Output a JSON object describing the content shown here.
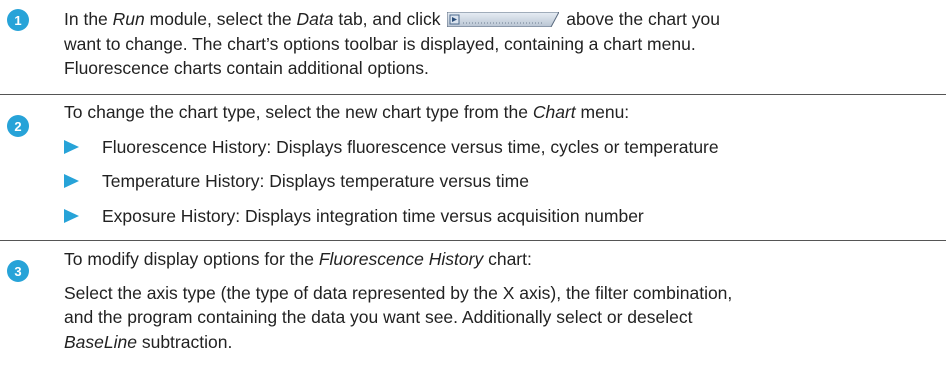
{
  "steps": [
    {
      "number": "1",
      "line1_a": "In the ",
      "line1_run": "Run",
      "line1_b": " module, select the ",
      "line1_data": "Data",
      "line1_c": " tab, and click ",
      "line1_d": " above the chart you",
      "line2": "want to change. The chart’s options toolbar is displayed, containing a chart menu.",
      "line3": "Fluorescence charts contain additional options."
    },
    {
      "number": "2",
      "intro_a": "To change the chart type, select the new chart type from the ",
      "intro_chart": "Chart",
      "intro_b": " menu:",
      "bullets": [
        "Fluorescence History: Displays fluorescence versus time, cycles or temperature",
        "Temperature History: Displays temperature versus time",
        "Exposure History: Displays integration time versus acquisition number"
      ]
    },
    {
      "number": "3",
      "intro_a": "To modify display options for the ",
      "intro_italic": "Fluorescence History",
      "intro_b": " chart:",
      "body1": "Select the axis type (the type of data represented by the X axis), the filter combination,",
      "body2": "and the program containing the data you want see. Additionally select or deselect",
      "body3_italic": "BaseLine",
      "body3_rest": " subtraction."
    }
  ],
  "colors": {
    "accent": "#27a3d8",
    "rule": "#555555",
    "text": "#222222"
  },
  "icons": {
    "toolbar_button": "chart-options-button-icon",
    "bullet": "triangle-bullet-icon"
  }
}
